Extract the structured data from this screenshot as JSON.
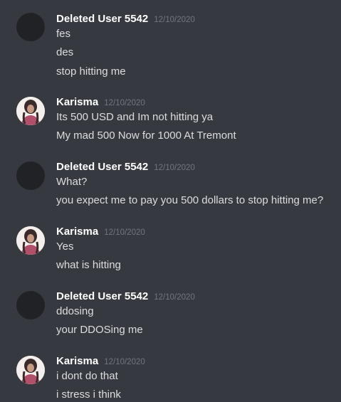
{
  "messages": [
    {
      "author": "Deleted User 5542",
      "timestamp": "12/10/2020",
      "avatar": "deleted-user-avatar",
      "lines": [
        "fes",
        "des",
        "stop hitting me"
      ]
    },
    {
      "author": "Karisma",
      "timestamp": "12/10/2020",
      "avatar": "user-photo-avatar",
      "lines": [
        "Its 500 USD and Im not hitting ya",
        "My mad 500 Now for 1000 At Tremont"
      ]
    },
    {
      "author": "Deleted User 5542",
      "timestamp": "12/10/2020",
      "avatar": "deleted-user-avatar",
      "lines": [
        "What?",
        "you expect me to pay you 500 dollars to stop hitting me?"
      ]
    },
    {
      "author": "Karisma",
      "timestamp": "12/10/2020",
      "avatar": "user-photo-avatar",
      "lines": [
        "Yes",
        "what is hitting"
      ]
    },
    {
      "author": "Deleted User 5542",
      "timestamp": "12/10/2020",
      "avatar": "deleted-user-avatar",
      "lines": [
        "ddosing",
        "your DDOSing me"
      ]
    },
    {
      "author": "Karisma",
      "timestamp": "12/10/2020",
      "avatar": "user-photo-avatar",
      "lines": [
        "i dont do that",
        "i stress i think"
      ]
    }
  ],
  "colors": {
    "background": "#36393f",
    "username": "#ffffff",
    "timestamp": "#72767d",
    "message_text": "#dcddde",
    "deleted_avatar": "#202225"
  }
}
